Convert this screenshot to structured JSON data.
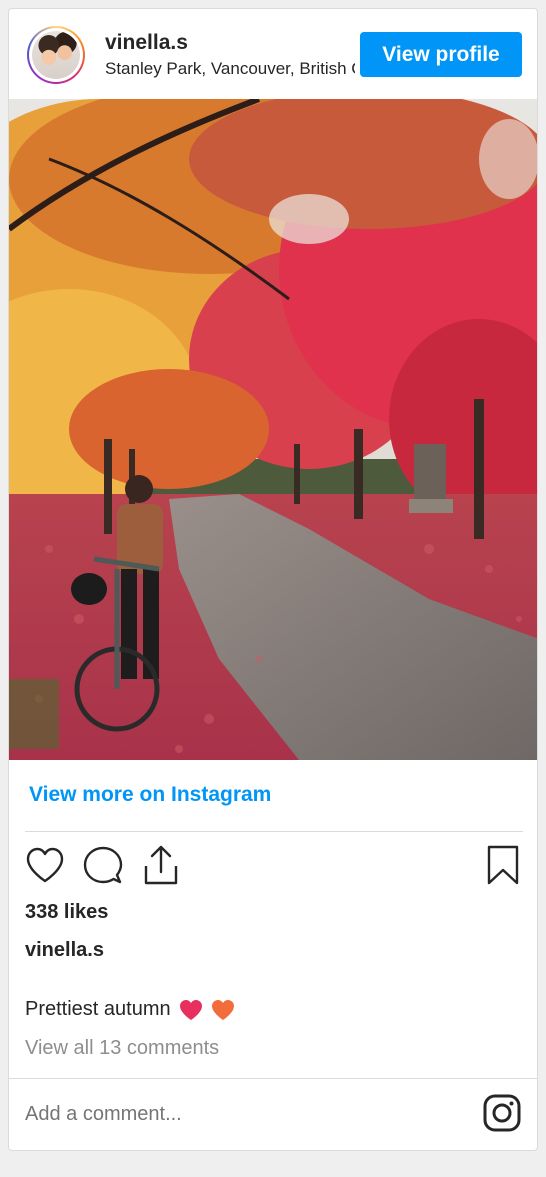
{
  "header": {
    "username": "vinella.s",
    "location": "Stanley Park, Vancouver, British Columbia",
    "view_profile_label": "View profile"
  },
  "post": {
    "image_description_icon": "photo",
    "view_more_label": "View more on Instagram",
    "likes_text": "338 likes",
    "caption_user": "vinella.s",
    "caption_text": "Prettiest autumn",
    "caption_emojis": [
      "pink-heart-emoji",
      "orange-heart-emoji"
    ],
    "view_comments_label": "View all 13 comments"
  },
  "actions": {
    "icons": [
      "heart-icon",
      "comment-icon",
      "share-icon",
      "bookmark-icon"
    ]
  },
  "comment_box": {
    "placeholder": "Add a comment..."
  },
  "colors": {
    "accent": "#0095f6",
    "muted_text": "#8e8e8e",
    "primary_text": "#262626",
    "border": "#dbdbdb"
  }
}
